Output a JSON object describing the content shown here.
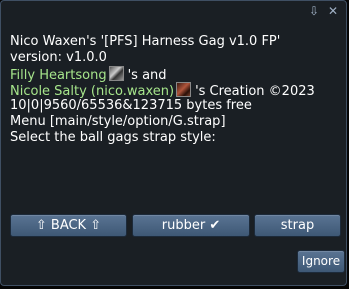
{
  "title_icons": [
    "download-icon",
    "close-icon"
  ],
  "message": {
    "line1": "Nico Waxen's '[PFS] Harness Gag v1.0 FP'",
    "line2": "version: v1.0.0",
    "creator1_name": "Filly Heartsong",
    "creator1_suffix": "'s and",
    "creator2_name": "Nicole Salty (nico.waxen)",
    "creator2_suffix": "'s Creation ©2023",
    "memory": "10|0|9560/65536&123715 bytes free",
    "menu": "Menu [main/style/option/G.strap]",
    "prompt": "Select the ball gags strap style:"
  },
  "buttons": {
    "back": "⇧ BACK ⇧",
    "rubber": "rubber ✔",
    "strap": "strap",
    "ignore": "Ignore"
  },
  "colors": {
    "background": "#1a1f24",
    "link": "#a6e58b",
    "button": "#4d6785"
  }
}
